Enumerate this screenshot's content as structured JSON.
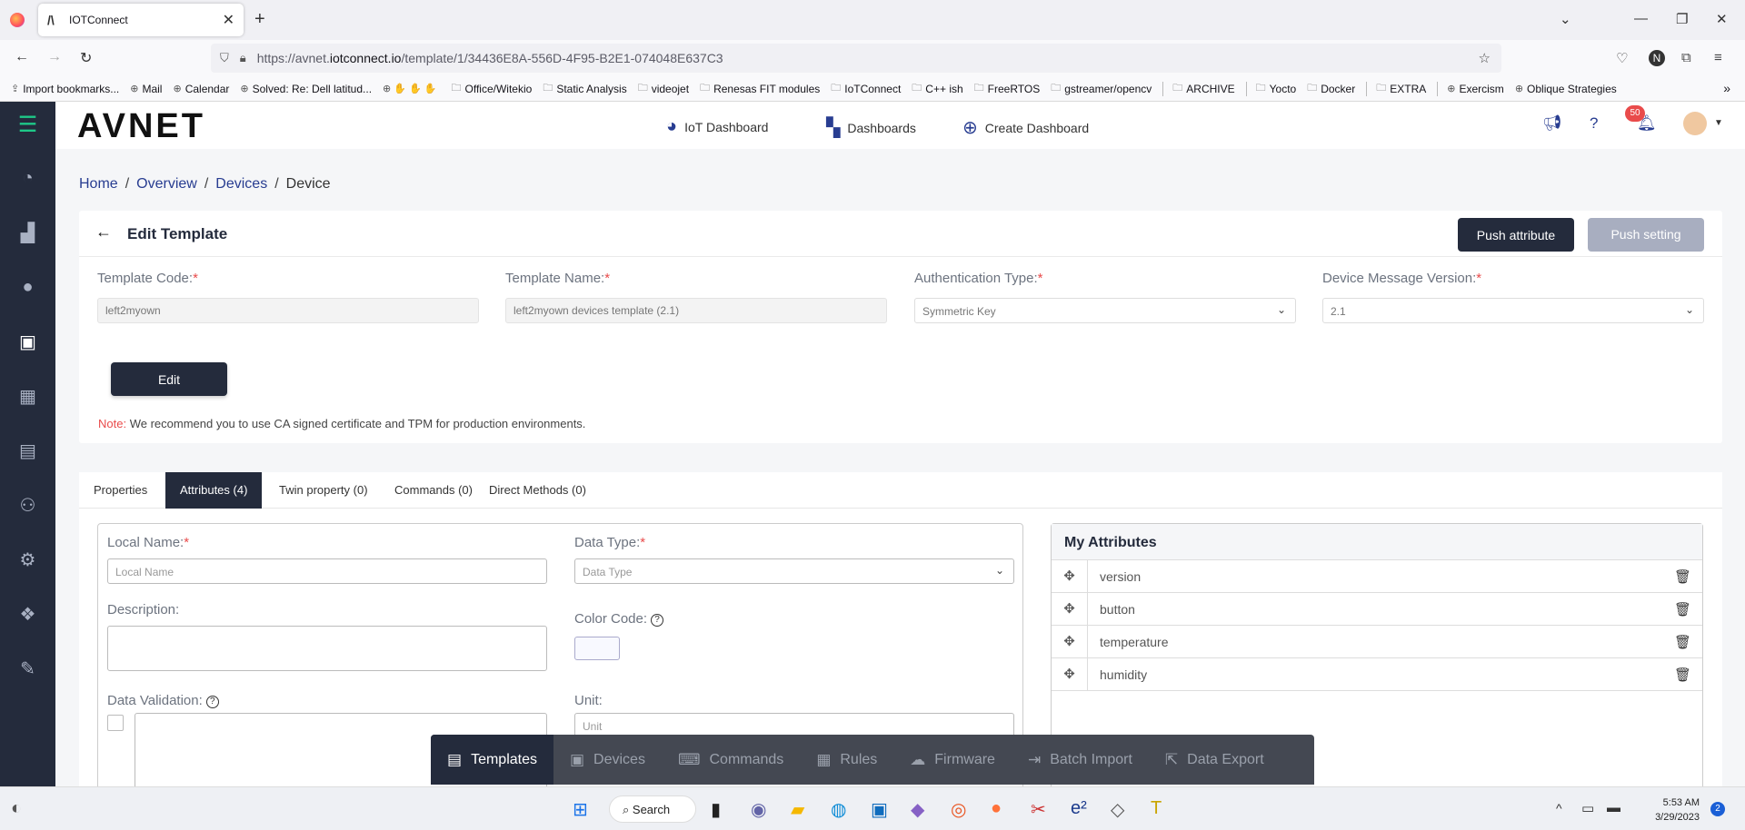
{
  "browser": {
    "tab_title": "IOTConnect",
    "url_prefix": "https://avnet.",
    "url_domain": "iotconnect.io",
    "url_path": "/template/1/34436E8A-556D-4F95-B2E1-074048E637C3",
    "bookmarks": [
      "Import bookmarks...",
      "Mail",
      "Calendar",
      "Solved: Re: Dell latitud...",
      "",
      "Office/Witekio",
      "Static Analysis",
      "videojet",
      "Renesas FIT modules",
      "IoTConnect",
      "C++ ish",
      "FreeRTOS",
      "gstreamer/opencv",
      "ARCHIVE",
      "Yocto",
      "Docker",
      "EXTRA",
      "Exercism",
      "Oblique Strategies"
    ]
  },
  "app": {
    "logo": "AVNET",
    "topnav": {
      "iot_dashboard": "IoT Dashboard",
      "dashboards": "Dashboards",
      "create_dashboard": "Create Dashboard"
    },
    "notif_count": "50",
    "breadcrumb": [
      "Home",
      "Overview",
      "Devices",
      "Device"
    ]
  },
  "template": {
    "title": "Edit Template",
    "push_attribute": "Push attribute",
    "push_setting": "Push setting",
    "edit_button": "Edit",
    "fields": {
      "code_label": "Template Code:",
      "code_value": "left2myown",
      "name_label": "Template Name:",
      "name_value": "left2myown devices template (2.1)",
      "auth_label": "Authentication Type:",
      "auth_value": "Symmetric Key",
      "version_label": "Device Message Version:",
      "version_value": "2.1"
    },
    "note_label": "Note:",
    "note_text": "We recommend you to use CA signed certificate and TPM for production environments."
  },
  "tabs": [
    "Properties",
    "Attributes (4)",
    "Twin property (0)",
    "Commands (0)",
    "Direct Methods (0)"
  ],
  "attr_form": {
    "local_name_label": "Local Name:",
    "local_name_placeholder": "Local Name",
    "data_type_label": "Data Type:",
    "data_type_placeholder": "Data Type",
    "description_label": "Description:",
    "color_code_label": "Color Code:",
    "data_validation_label": "Data Validation:",
    "unit_label": "Unit:",
    "unit_placeholder": "Unit"
  },
  "my_attributes": {
    "title": "My Attributes",
    "items": [
      "version",
      "button",
      "temperature",
      "humidity"
    ]
  },
  "floatbar": [
    "Templates",
    "Devices",
    "Commands",
    "Rules",
    "Firmware",
    "Batch Import",
    "Data Export"
  ],
  "taskbar": {
    "search": "Search",
    "time": "5:53 AM",
    "date": "3/29/2023",
    "notif": "2"
  }
}
